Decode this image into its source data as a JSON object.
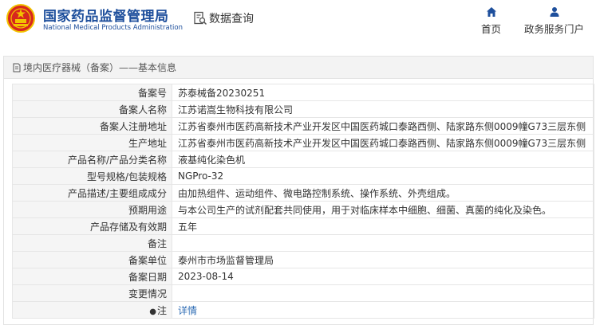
{
  "header": {
    "brand_cn": "国家药品监督管理局",
    "brand_en": "National Medical Products Administration",
    "data_query": "数据查询",
    "nav": [
      {
        "label": "首页",
        "icon": "home-icon"
      },
      {
        "label": "政务服务门户",
        "icon": "user-icon"
      }
    ]
  },
  "breadcrumb": "境内医疗器械（备案）——基本信息",
  "rows": [
    {
      "label": "备案号",
      "value": "苏泰械备20230251"
    },
    {
      "label": "备案人名称",
      "value": "江苏诺嵩生物科技有限公司"
    },
    {
      "label": "备案人注册地址",
      "value": "江苏省泰州市医药高新技术产业开发区中国医药城口泰路西侧、陆家路东侧0009幢G73三层东侧"
    },
    {
      "label": "生产地址",
      "value": "江苏省泰州市医药高新技术产业开发区中国医药城口泰路西侧、陆家路东侧0009幢G73三层东侧"
    },
    {
      "label": "产品名称/产品分类名称",
      "value": "液基纯化染色机"
    },
    {
      "label": "型号规格/包装规格",
      "value": "NGPro-32"
    },
    {
      "label": "产品描述/主要组成成分",
      "value": "由加热组件、运动组件、微电路控制系统、操作系统、外壳组成。"
    },
    {
      "label": "预期用途",
      "value": "与本公司生产的试剂配套共同使用，用于对临床样本中细胞、细菌、真菌的纯化及染色。"
    },
    {
      "label": "产品存储及有效期",
      "value": "五年"
    },
    {
      "label": "备注",
      "value": ""
    },
    {
      "label": "备案单位",
      "value": "泰州市市场监督管理局"
    },
    {
      "label": "备案日期",
      "value": "2023-08-14"
    },
    {
      "label": "变更情况",
      "value": ""
    },
    {
      "label": "注",
      "value": "详情",
      "icon": "bulb-icon"
    }
  ],
  "colors": {
    "brand_blue": "#1e4f9c",
    "link_blue": "#2f6db5",
    "label_bg": "#f5f5f5",
    "emblem_red": "#d7261e",
    "emblem_gold": "#f2c200"
  }
}
